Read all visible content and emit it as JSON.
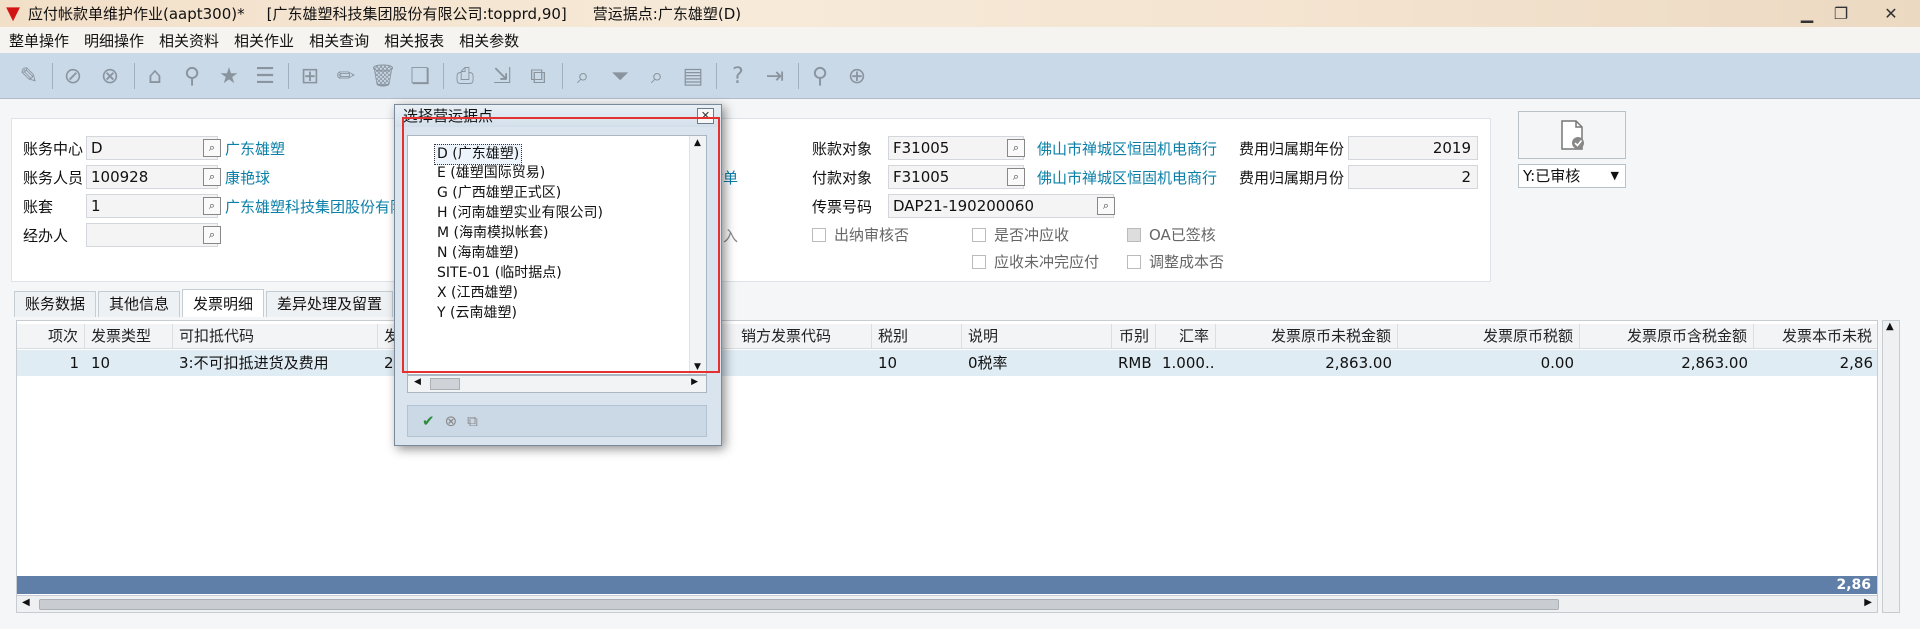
{
  "window": {
    "title": "应付帐款单维护作业(aapt300)*",
    "company": "[广东雄塑科技集团股份有限公司:topprd,90]",
    "site": "营运据点:广东雄塑(D)"
  },
  "menu": [
    "整单操作",
    "明细操作",
    "相关资料",
    "相关作业",
    "相关查询",
    "相关报表",
    "相关参数"
  ],
  "form": {
    "center_label": "账务中心",
    "center_value": "D",
    "center_name": "广东雄塑",
    "staff_label": "账务人员",
    "staff_value": "100928",
    "staff_name": "康艳球",
    "ledger_label": "账套",
    "ledger_value": "1",
    "ledger_name": "广东雄塑科技集团股份有限公司",
    "handler_label": "经办人",
    "partial_pay": "付单",
    "partial_in": "入",
    "vendor_label": "账款对象",
    "vendor_value": "F31005",
    "vendor_name": "佛山市禅城区恒固机电商行",
    "payee_label": "付款对象",
    "payee_value": "F31005",
    "payee_name": "佛山市禅城区恒固机电商行",
    "voucher_label": "传票号码",
    "voucher_value": "DAP21-190200060",
    "year_label": "费用归属期年份",
    "year_value": "2019",
    "month_label": "费用归属期月份",
    "month_value": "2",
    "chk_cashier": "出纳审核否",
    "chk_offset": "是否冲应收",
    "chk_oa": "OA已签核",
    "chk_unpaid": "应收未冲完应付",
    "chk_cost": "调整成本否",
    "status_value": "Y:已审核"
  },
  "tabs": [
    "账务数据",
    "其他信息",
    "发票明细",
    "差异处理及留置"
  ],
  "grid": {
    "headers": [
      "项次",
      "发票类型",
      "可扣抵代码",
      "发",
      "销方发票代码",
      "税别",
      "说明",
      "币别",
      "汇率",
      "发票原币未税金额",
      "发票原币税额",
      "发票原币含税金额",
      "发票本币未税"
    ],
    "row": [
      "1",
      "10",
      "3:不可扣抵进货及费用",
      "20",
      "",
      "10",
      "0税率",
      "RMB",
      "1.000...",
      "2,863.00",
      "0.00",
      "2,863.00",
      "2,86"
    ],
    "total": "2,86"
  },
  "dialog": {
    "title": "选择营运据点",
    "items": [
      "D (广东雄塑)",
      "E (雄塑国际贸易)",
      "G (广西雄塑正式区)",
      "H (河南雄塑实业有限公司)",
      "M (海南模拟帐套)",
      "N (海南雄塑)",
      "SITE-01 (临时据点)",
      "X (江西雄塑)",
      "Y (云南雄塑)"
    ],
    "selected_index": 0
  },
  "colors": {
    "toolbar": "#c9d9e7",
    "link": "#0b7fa8",
    "highlight": "#e53030",
    "row_selected": "#dfecf4"
  }
}
